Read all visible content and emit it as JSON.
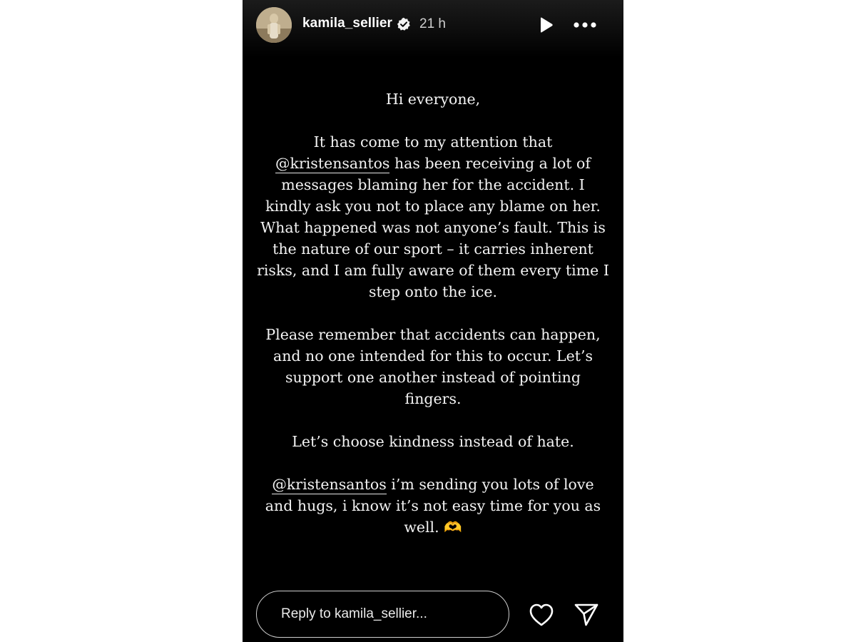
{
  "header": {
    "username": "kamila_sellier",
    "time": "21 h",
    "icons": {
      "avatar": "profile-photo",
      "verified": "verified-badge-icon",
      "play": "play-icon",
      "more": "more-options-icon"
    }
  },
  "story": {
    "greeting": "Hi everyone,",
    "p1_before": "It has come to my attention that",
    "mention1": "@kristensantos",
    "p1_after": "has been receiving a lot of messages blaming her for the accident. I kindly ask you not to place any blame on her. What happened was not anyone’s fault. This is the nature of our sport – it carries inherent risks, and I am fully aware of them every time I step onto the ice.",
    "p2": "Please remember that accidents can happen, and no one intended for this to occur. Let’s support one another instead of pointing fingers.",
    "p3": "Let’s choose kindness instead of hate.",
    "mention2": "@kristensantos",
    "p4_after": "i’m sending you lots of love and hugs, i know it’s not easy time for you as well.",
    "emoji": "🫶"
  },
  "footer": {
    "reply_placeholder": "Reply to kamila_sellier...",
    "icons": {
      "like": "heart-icon",
      "share": "send-icon"
    }
  },
  "colors": {
    "background": "#000000",
    "text": "#f2f2f2",
    "muted": "#cfcfcf"
  }
}
